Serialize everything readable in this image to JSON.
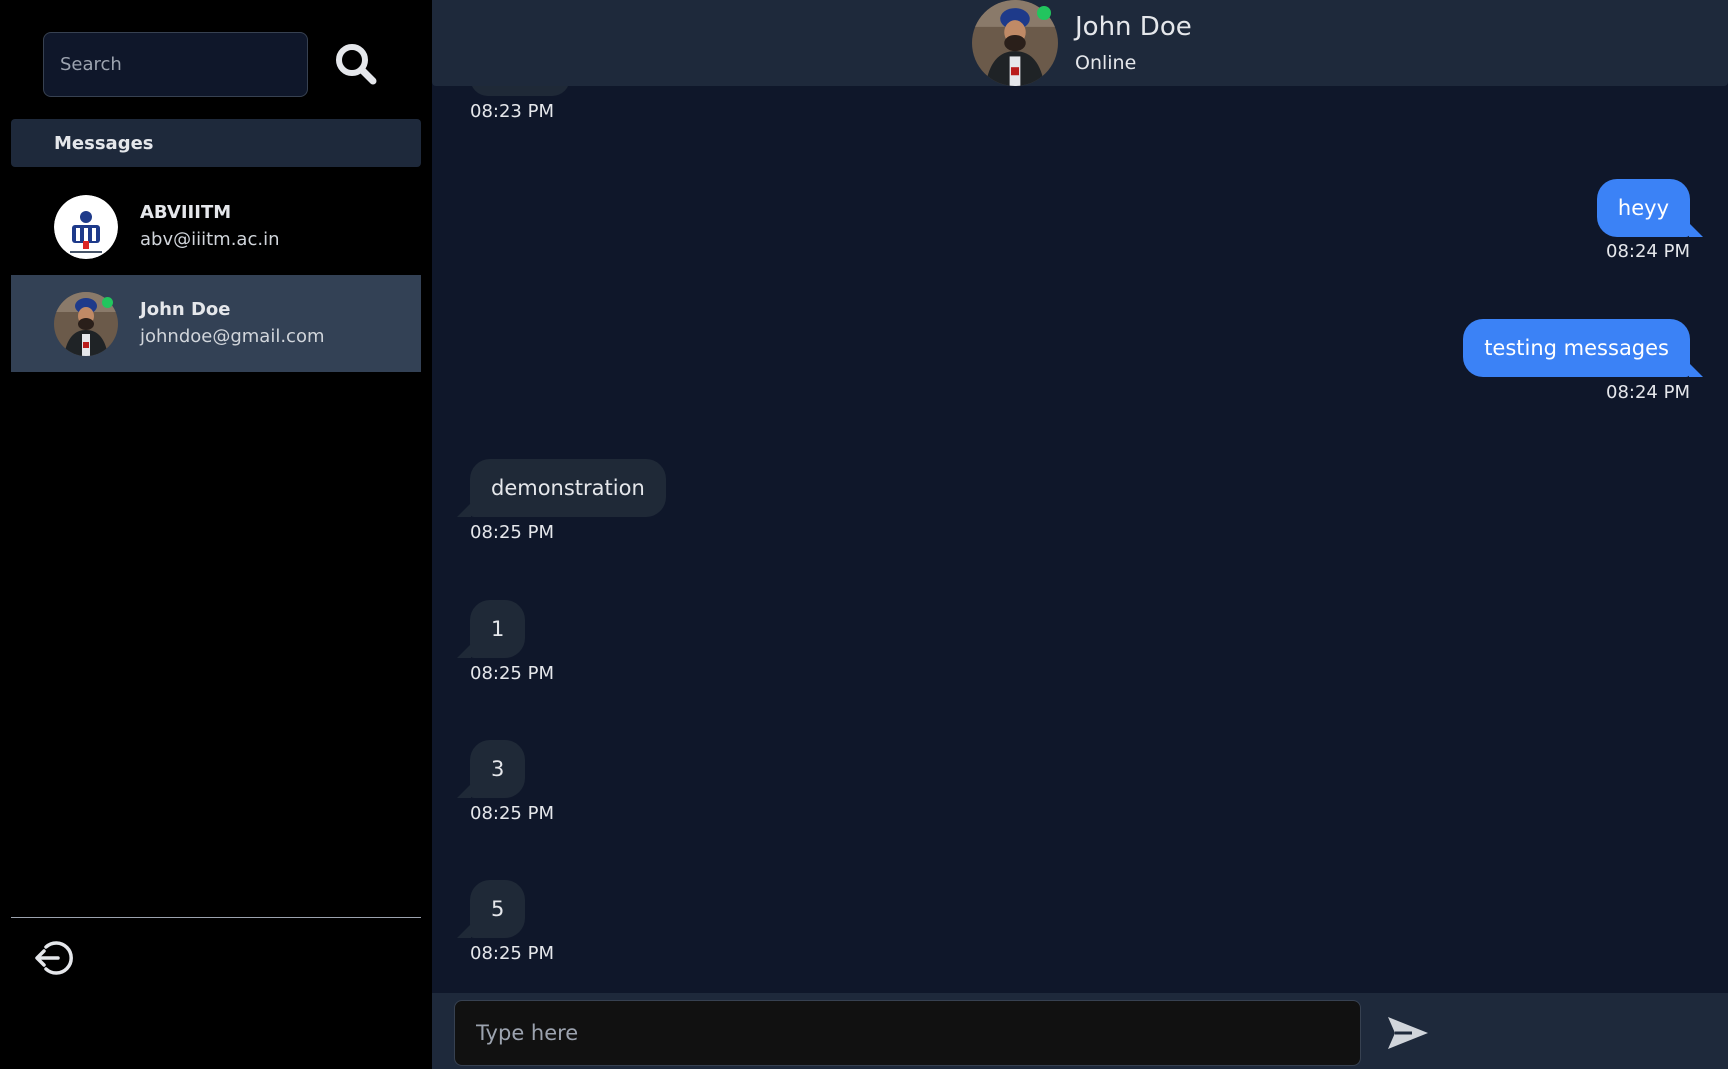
{
  "sidebar": {
    "search": {
      "placeholder": "Search",
      "icon": "search-icon"
    },
    "section_title": "Messages",
    "contacts": [
      {
        "name": "ABVIIITM",
        "email": "abv@iiitm.ac.in",
        "online": false,
        "active": false
      },
      {
        "name": "John Doe",
        "email": "johndoe@gmail.com",
        "online": true,
        "active": true
      }
    ],
    "logout_icon": "logout-icon"
  },
  "chat": {
    "header": {
      "name": "John Doe",
      "status": "Online"
    },
    "messages": [
      {
        "direction": "in",
        "text": "",
        "time": "08:23 PM"
      },
      {
        "direction": "out",
        "text": "heyy",
        "time": "08:24 PM"
      },
      {
        "direction": "out",
        "text": "testing messages",
        "time": "08:24 PM"
      },
      {
        "direction": "in",
        "text": "demonstration",
        "time": "08:25 PM"
      },
      {
        "direction": "in",
        "text": "1",
        "time": "08:25 PM"
      },
      {
        "direction": "in",
        "text": "3",
        "time": "08:25 PM"
      },
      {
        "direction": "in",
        "text": "5",
        "time": "08:25 PM"
      }
    ],
    "composer": {
      "placeholder": "Type here",
      "send_icon": "send-icon"
    }
  },
  "colors": {
    "sidebar_bg": "#000000",
    "chat_bg": "#0f172a",
    "header_bg": "#1e293b",
    "active_contact_bg": "#334155",
    "incoming_bubble": "#1f2937",
    "outgoing_bubble": "#3b82f6",
    "online": "#22c55e"
  }
}
